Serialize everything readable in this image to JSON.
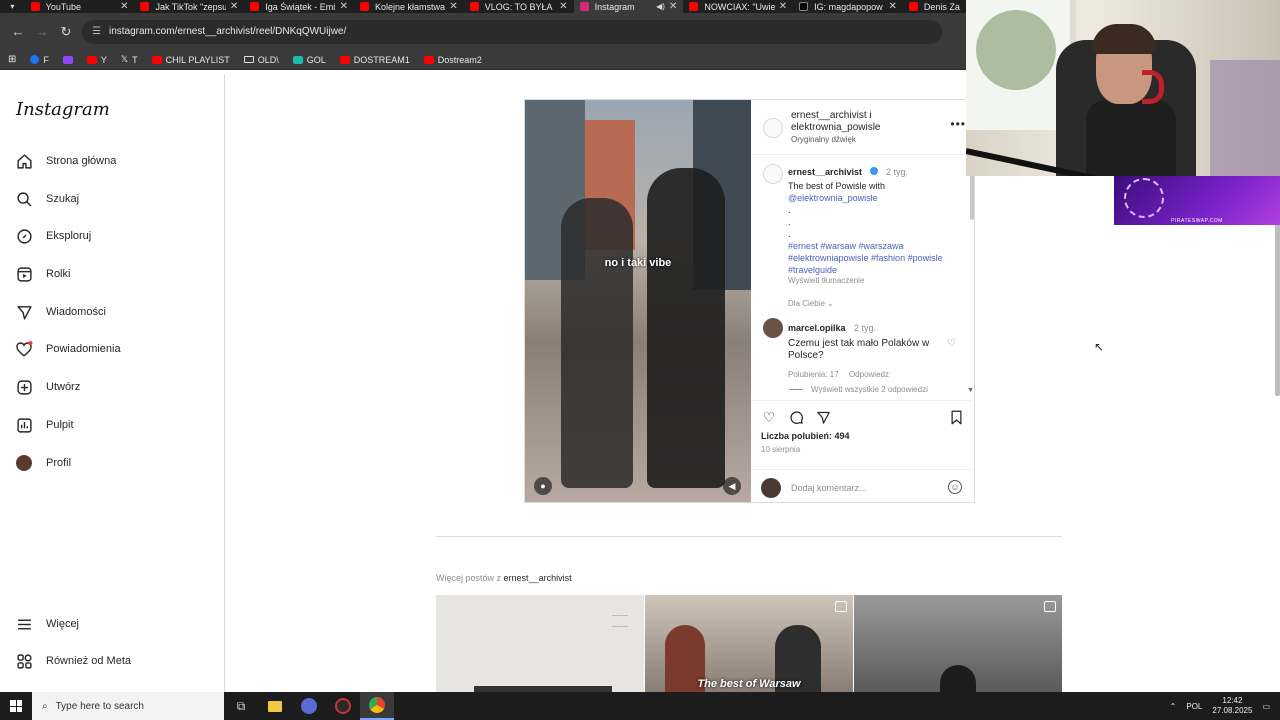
{
  "browser": {
    "tabs": [
      {
        "title": "YouTube",
        "color": "#ff0000",
        "active": false
      },
      {
        "title": "Jak TikTok \"zepsu",
        "color": "#ff0000",
        "active": false
      },
      {
        "title": "Iga Świątek - Emi",
        "color": "#ff0000",
        "active": false
      },
      {
        "title": "Kolejne kłamstwa",
        "color": "#ff0000",
        "active": false
      },
      {
        "title": "VLOG: TO BYŁA N",
        "color": "#ff0000",
        "active": false
      },
      {
        "title": "Instagram",
        "color": "#d62976",
        "active": true
      },
      {
        "title": "NOWCIAX: \"Uwie",
        "color": "#ff0000",
        "active": false
      },
      {
        "title": "IG: magdapopow",
        "color": "#000000",
        "active": false
      },
      {
        "title": "Denis Za",
        "color": "#ff0000",
        "active": false
      }
    ],
    "url": "instagram.com/ernest__archivist/reel/DNKqQWUijwe/",
    "bookmarks": [
      {
        "label": "F",
        "color": "#1877f2"
      },
      {
        "label": "",
        "color": "#9146ff"
      },
      {
        "label": "Y",
        "color": "#ff0000"
      },
      {
        "label": "T",
        "color": "#000000"
      },
      {
        "label": "CHIL PLAYLIST",
        "color": "#ff0000"
      },
      {
        "label": "OLD\\",
        "color": "folder"
      },
      {
        "label": "GOL",
        "color": "#1fb8b0"
      },
      {
        "label": "DOSTREAM1",
        "color": "#ff0000"
      },
      {
        "label": "Dostream2",
        "color": "#ff0000"
      }
    ]
  },
  "instagram": {
    "logo": "Instagram",
    "nav": [
      {
        "label": "Strona główna",
        "icon": "home-icon"
      },
      {
        "label": "Szukaj",
        "icon": "search-icon"
      },
      {
        "label": "Eksploruj",
        "icon": "compass-icon"
      },
      {
        "label": "Rolki",
        "icon": "reels-icon"
      },
      {
        "label": "Wiadomości",
        "icon": "messages-icon"
      },
      {
        "label": "Powiadomienia",
        "icon": "heart-icon"
      },
      {
        "label": "Utwórz",
        "icon": "plus-icon"
      },
      {
        "label": "Pulpit",
        "icon": "dashboard-icon"
      },
      {
        "label": "Profil",
        "icon": "profile-avatar"
      }
    ],
    "nav_bottom": [
      {
        "label": "Więcej",
        "icon": "menu-icon"
      },
      {
        "label": "Również od Meta",
        "icon": "meta-icon"
      }
    ],
    "post": {
      "video_caption": "no i taki vibe",
      "header_names_line1": "ernest__archivist i",
      "header_names_line2": "elektrownia_powisle",
      "header_audio": "Oryginalny dźwięk",
      "caption_user": "ernest__archivist",
      "caption_time": "2 tyg.",
      "caption_line1": "The best of Powiśle with",
      "caption_mention": "@elektrownia_powisle",
      "caption_dots": ".",
      "hashtags_line1": "#ernest #warsaw #warszawa",
      "hashtags_line2": "#elektrowniapowisle #fashion #powisle",
      "hashtags_line3": "#travelguide",
      "translate": "Wyświetl tłumaczenie",
      "for_you": "Dla Ciebie",
      "comment_user": "marcel.opilka",
      "comment_time": "2 tyg.",
      "comment_text": "Czemu jest tak mało Polaków w Polsce?",
      "comment_likes": "Polubienia: 17",
      "comment_reply": "Odpowiedz",
      "view_replies": "Wyświetl wszystkie 2 odpowiedzi",
      "likes": "Liczba polubień: 494",
      "date": "10 sierpnia",
      "add_comment_placeholder": "Dodaj komentarz..."
    },
    "more_posts_prefix": "Więcej postów z",
    "more_posts_user": "ernest__archivist",
    "thumb_caption": "The best of Warsaw"
  },
  "banner_text": "PIRATESWAP.COM",
  "taskbar": {
    "search_placeholder": "Type here to search",
    "lang": "POL",
    "time": "12:42",
    "date": "27.08.2025"
  }
}
